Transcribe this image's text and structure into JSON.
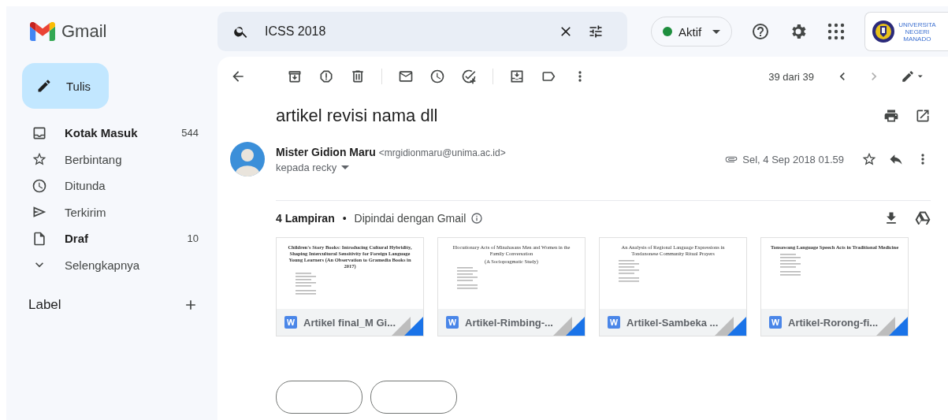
{
  "app": {
    "name": "Gmail"
  },
  "search": {
    "value": "ICSS 2018"
  },
  "status": {
    "label": "Aktif",
    "color": "#1e8e3e"
  },
  "org_logo": {
    "lines": [
      "UNIVERSITA",
      "NEGERI",
      "MANADO"
    ]
  },
  "compose": {
    "label": "Tulis"
  },
  "sidebar": {
    "items": [
      {
        "label": "Kotak Masuk",
        "count": "544",
        "unread": true
      },
      {
        "label": "Berbintang",
        "unread": false
      },
      {
        "label": "Ditunda",
        "unread": false
      },
      {
        "label": "Terkirim",
        "unread": false
      },
      {
        "label": "Draf",
        "count": "10",
        "unread": true
      },
      {
        "label": "Selengkapnya",
        "unread": false
      }
    ],
    "labels_heading": "Label"
  },
  "toolbar": {
    "position": "39 dari 39"
  },
  "message": {
    "subject": "artikel revisi nama dll",
    "sender_name": "Mister Gidion Maru",
    "sender_email": "<mrgidionmaru@unima.ac.id>",
    "recipient": "kepada recky",
    "date": "Sel, 4 Sep 2018 01.59",
    "starred": false
  },
  "attachments": {
    "count_label": "4 Lampiran",
    "separator": "•",
    "scan_note": "Dipindai dengan Gmail",
    "items": [
      {
        "file": "Artikel final_M Gi...",
        "doc_title": "Children's Story Books: Introducing Cultural Hybridity, Shaping Intercultural Sensitivity for Foreign Language Young Learners (An Observation to Gramedia Books in 2017)",
        "title_bold": true
      },
      {
        "file": "Artikel-Rimbing-...",
        "doc_title": "Illocutionary Acts of Minahasans Men and Women in the Family Conversation",
        "doc_subtitle": "(A Sociopragmatic Study)",
        "title_bold": false
      },
      {
        "file": "Artikel-Sambeka ...",
        "doc_title": "An Analysis of Regional Language Expressions in Tondanonese Community Ritual Prayers",
        "title_bold": false
      },
      {
        "file": "Artikel-Rorong-fi...",
        "doc_title": "Tonsawang Language Speech Acts in Traditional Medicine",
        "title_bold": true
      }
    ]
  }
}
